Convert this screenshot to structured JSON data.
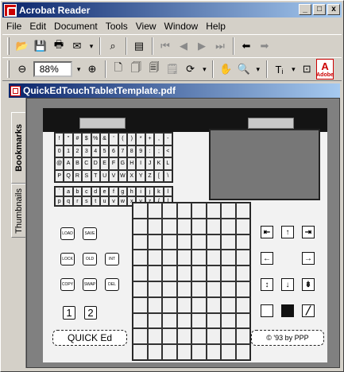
{
  "window": {
    "title": "Acrobat Reader",
    "minimize": "_",
    "maximize": "□",
    "close": "x"
  },
  "menu": [
    "File",
    "Edit",
    "Document",
    "Tools",
    "View",
    "Window",
    "Help"
  ],
  "toolbar": {
    "zoom_value": "88%"
  },
  "document": {
    "title": "QuickEdTouchTabletTemplate.pdf"
  },
  "nav_tabs": {
    "bookmarks": "Bookmarks",
    "thumbnails": "Thumbnails"
  },
  "template": {
    "keyboard_row1": [
      "!",
      "\"",
      "#",
      "$",
      "%",
      "&",
      "'",
      "(",
      ")",
      "*",
      "+",
      ",",
      "-"
    ],
    "keyboard_row2": [
      "0",
      "1",
      "2",
      "3",
      "4",
      "5",
      "6",
      "7",
      "8",
      "9",
      ":",
      ";",
      "<"
    ],
    "keyboard_row3": [
      "@",
      "A",
      "B",
      "C",
      "D",
      "E",
      "F",
      "G",
      "H",
      "I",
      "J",
      "K",
      "L"
    ],
    "keyboard_row4": [
      "P",
      "Q",
      "R",
      "S",
      "T",
      "U",
      "V",
      "W",
      "X",
      "Y",
      "Z",
      "[",
      "\\"
    ],
    "keyboard_row5": [
      "`",
      "a",
      "b",
      "c",
      "d",
      "e",
      "f",
      "g",
      "h",
      "i",
      "j",
      "k",
      "l"
    ],
    "keyboard_row6": [
      "p",
      "q",
      "r",
      "s",
      "t",
      "u",
      "v",
      "w",
      "x",
      "y",
      "z",
      "{",
      "|"
    ],
    "left_keys": [
      "LOAD",
      "SAVE",
      "LOCK",
      "OLD",
      "INT",
      "COPY",
      "SWAP",
      "DEL"
    ],
    "num_keys": [
      "1",
      "2"
    ],
    "brand_label": "QUICK Ed",
    "copyright_label": "© '93 by PPP"
  }
}
